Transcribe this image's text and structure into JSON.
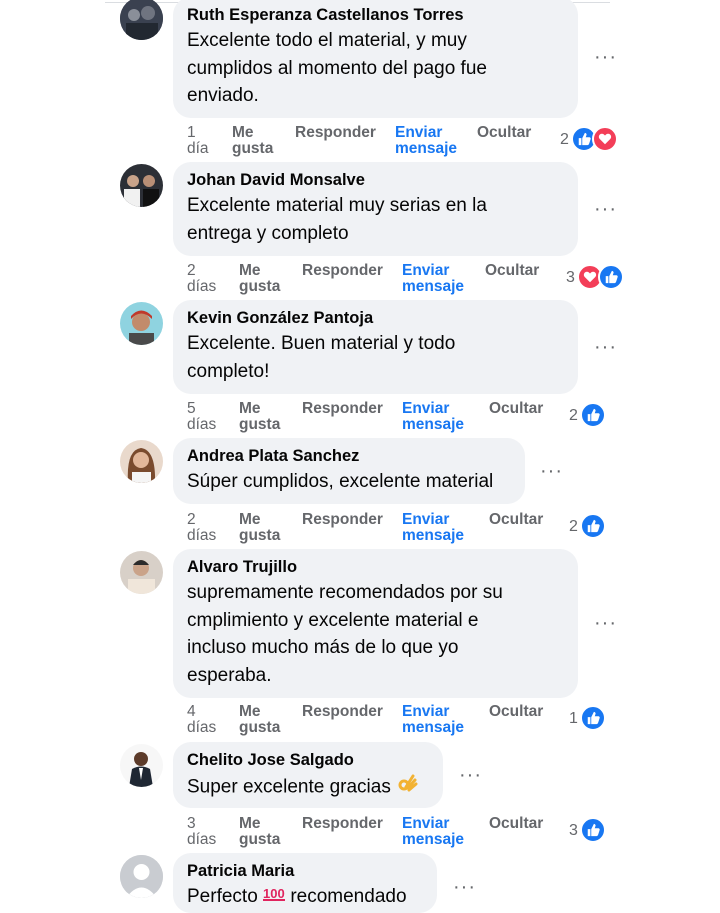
{
  "actions": {
    "like": "Me\ngusta",
    "reply": "Responder",
    "message": "Enviar\nmensaje",
    "hide": "Ocultar"
  },
  "comments": [
    {
      "author": "Ruth Esperanza Castellanos Torres",
      "lines": [
        "Excelente todo el material, y muy",
        "cumplidos al momento del pago fue",
        "enviado."
      ],
      "time": "1\ndía",
      "reactions": "2",
      "icons": [
        "like",
        "love"
      ]
    },
    {
      "author": "Johan David Monsalve",
      "lines": [
        "Excelente material muy serias en la",
        "entrega y completo"
      ],
      "time": "2\ndías",
      "reactions": "3",
      "icons": [
        "love",
        "like"
      ]
    },
    {
      "author": "Kevin González Pantoja",
      "lines": [
        "Excelente. Buen material y todo",
        "completo!"
      ],
      "time": "5\ndías",
      "reactions": "2",
      "icons": [
        "like"
      ]
    },
    {
      "author": "Andrea Plata Sanchez",
      "lines": [
        "Súper cumplidos, excelente material"
      ],
      "time": "2\ndías",
      "reactions": "2",
      "icons": [
        "like"
      ]
    },
    {
      "author": "Alvaro Trujillo",
      "lines": [
        "supremamente recomendados por su",
        "cmplimiento y excelente material e",
        "incluso mucho más de lo que yo",
        "esperaba."
      ],
      "time": "4\ndías",
      "reactions": "1",
      "icons": [
        "like"
      ]
    },
    {
      "author": "Chelito Jose Salgado",
      "lines": [
        "Super excelente gracias"
      ],
      "emoji": "ok-hand",
      "time": "3\ndías",
      "reactions": "3",
      "icons": [
        "like"
      ]
    },
    {
      "author": "Patricia Maria",
      "lines": [
        "Perfecto",
        "recomendado"
      ],
      "emoji": "hundred"
    }
  ]
}
